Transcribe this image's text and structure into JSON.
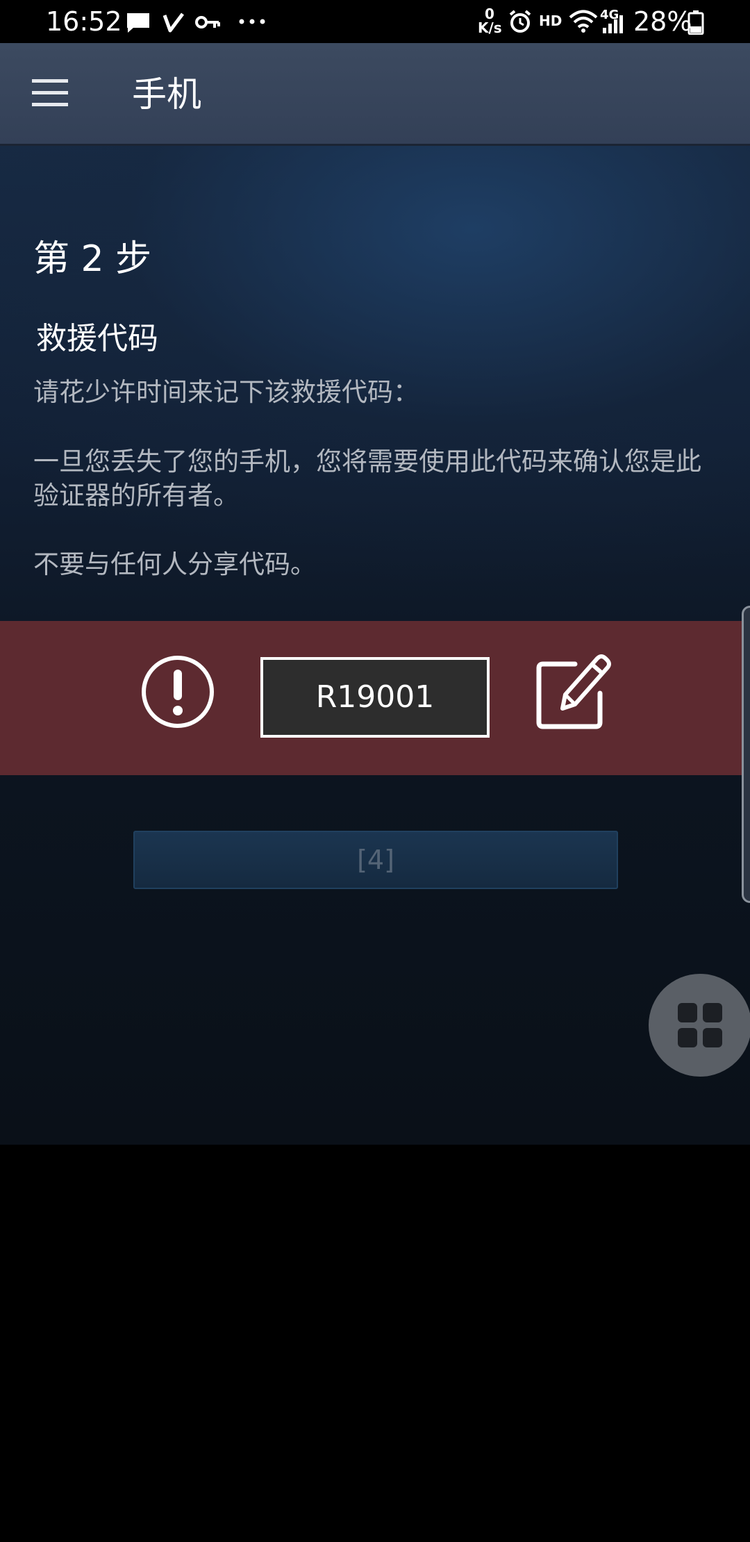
{
  "status_bar": {
    "time": "16:52",
    "net_speed_top": "0",
    "net_speed_unit": "K/s",
    "hd_label": "HD",
    "network_label": "4G",
    "battery": "28%",
    "icons": [
      "message-icon",
      "check-icon",
      "key-icon",
      "more-icon",
      "alarm-icon",
      "wifi-icon",
      "signal-icon",
      "battery-icon"
    ]
  },
  "app_bar": {
    "title": "手机",
    "menu_icon": "hamburger-menu-icon"
  },
  "content": {
    "step_title": "第 2 步",
    "section_title": "救援代码",
    "paragraph1": "请花少许时间来记下该救援代码：",
    "paragraph2": "一旦您丢失了您的手机，您将需要使用此代码来确认您是此验证器的所有者。",
    "paragraph3": "不要与任何人分享代码。"
  },
  "code_band": {
    "alert_icon": "alert-circle-icon",
    "code": "R19001",
    "edit_icon": "edit-icon",
    "band_color": "#5d2a30"
  },
  "next_button": {
    "label": "[4]"
  },
  "fab": {
    "icon": "grid-icon"
  },
  "colors": {
    "app_bar": "#3a475c",
    "content_top": "#172a44",
    "content_bottom": "#0a1018",
    "muted_text": "#b3b8c0",
    "button_text": "#546476"
  }
}
